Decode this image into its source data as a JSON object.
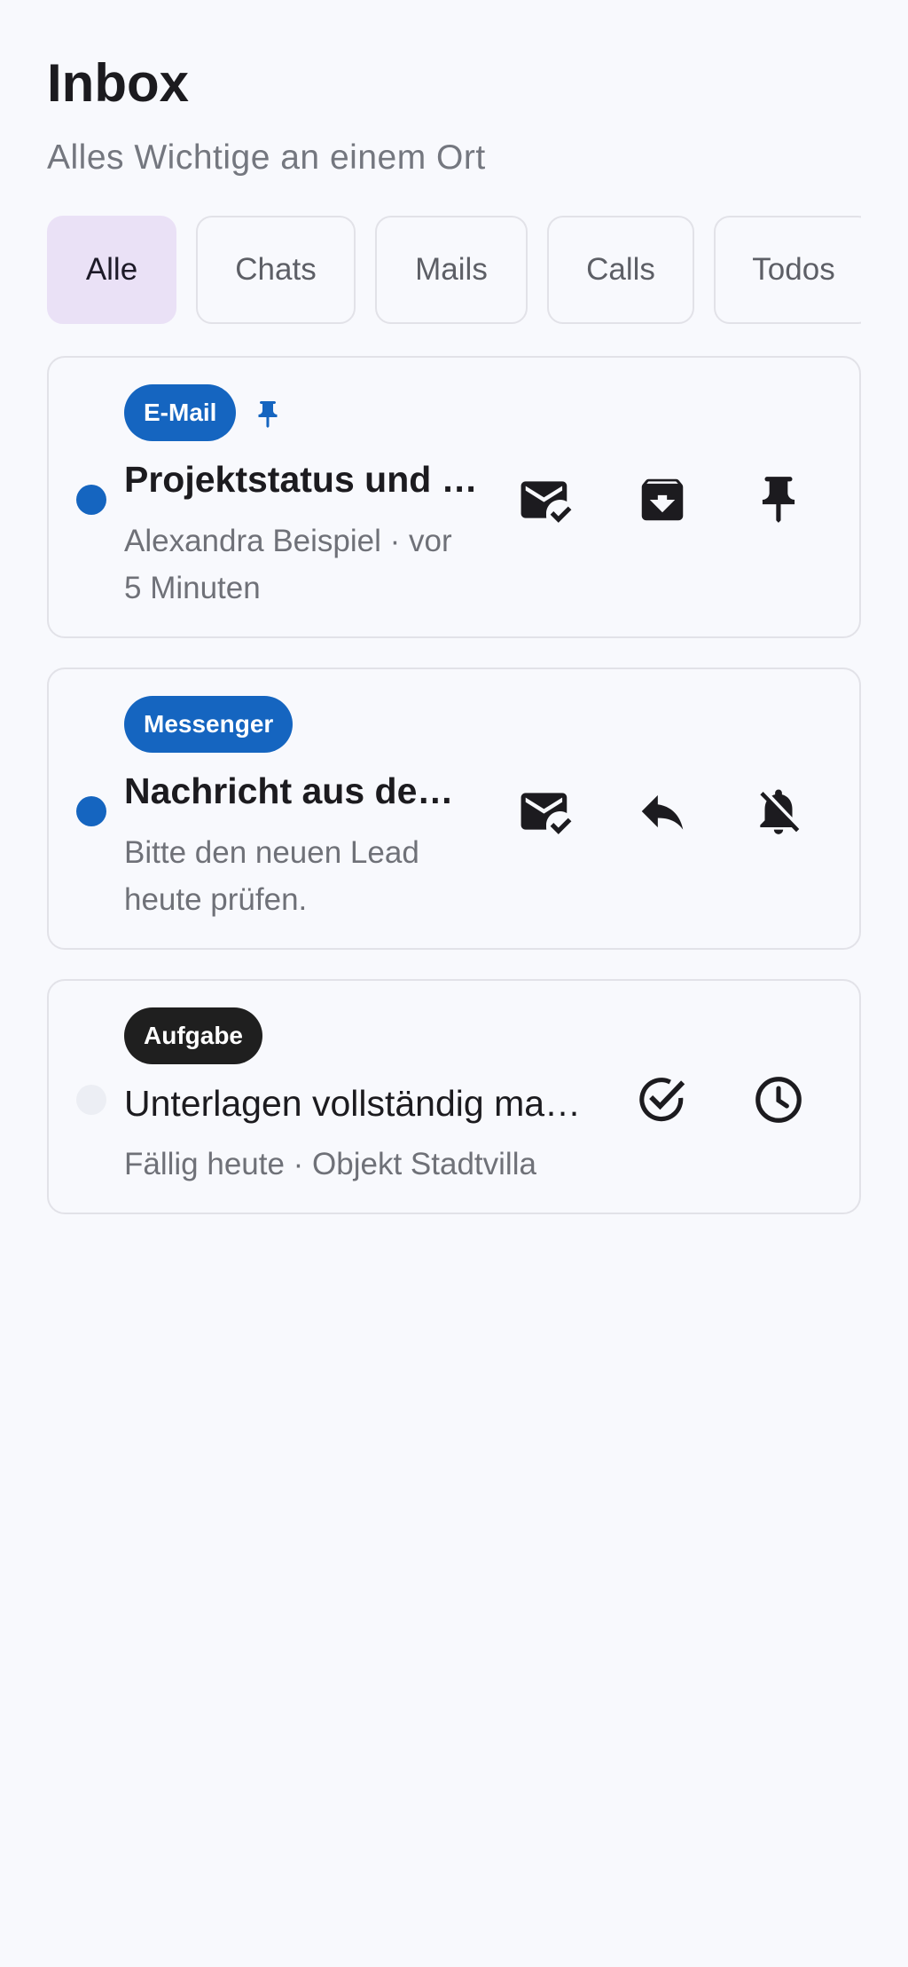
{
  "header": {
    "title": "Inbox",
    "subtitle": "Alles Wichtige an einem Ort"
  },
  "tabs": [
    {
      "label": "Alle",
      "active": true
    },
    {
      "label": "Chats",
      "active": false
    },
    {
      "label": "Mails",
      "active": false
    },
    {
      "label": "Calls",
      "active": false
    },
    {
      "label": "Todos",
      "active": false
    }
  ],
  "items": [
    {
      "badge": "E-Mail",
      "pinned": true,
      "unread": true,
      "title": "Projektstatus und nächste Schritte",
      "subtitle_line1": "Alexandra Beispiel · vor",
      "subtitle_line2": "5 Minuten",
      "actions": [
        "mark-read-icon",
        "archive-icon",
        "pin-icon"
      ]
    },
    {
      "badge": "Messenger",
      "pinned": false,
      "unread": true,
      "title": "Nachricht aus dem Messenger",
      "subtitle_line1": "Bitte den neuen Lead",
      "subtitle_line2": "heute prüfen.",
      "actions": [
        "mark-read-icon",
        "reply-icon",
        "mute-notifications-icon"
      ]
    },
    {
      "badge": "Aufgabe",
      "pinned": false,
      "unread": false,
      "title": "Unterlagen vollständig machen",
      "subtitle_line1": "Fällig heute · Objekt Stadtvilla",
      "actions": [
        "complete-task-icon",
        "snooze-clock-icon"
      ]
    }
  ],
  "colors": {
    "background": "#f8f9fd",
    "accent": "#1565c0",
    "active_tab": "#eae1f6",
    "task_badge": "#1f1f1f"
  }
}
